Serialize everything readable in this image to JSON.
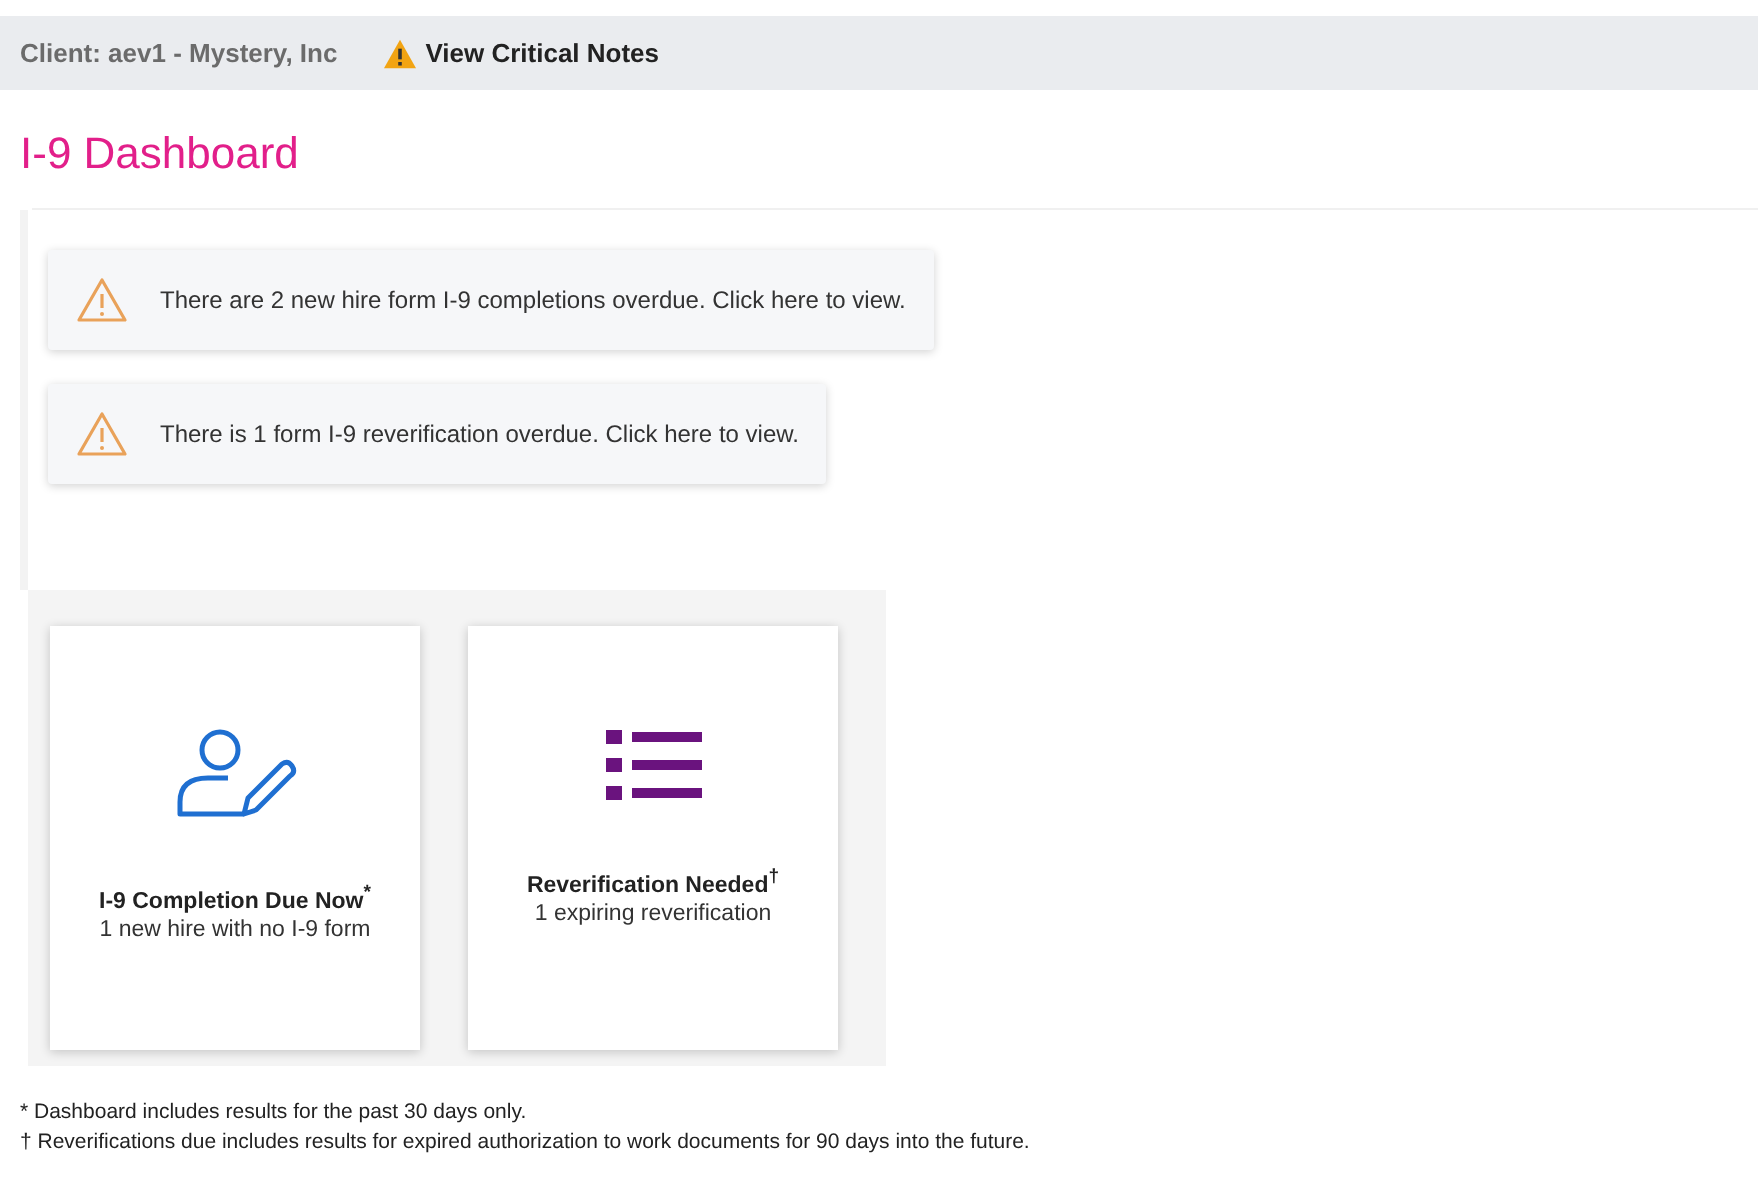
{
  "header": {
    "client": "Client: aev1 - Mystery, Inc",
    "critical_notes": "View Critical Notes"
  },
  "title": "I-9 Dashboard",
  "alerts": [
    "There are 2 new hire form I-9 completions overdue. Click here to view.",
    "There is 1 form I-9 reverification overdue. Click here to view."
  ],
  "cards": [
    {
      "kind": "person-edit",
      "title": "I-9 Completion Due Now$^{*}$",
      "subtitle": "1 new hire with no I-9 form"
    },
    {
      "kind": "list",
      "title": "Reverification Needed$^{†}$",
      "subtitle": "1 expiring reverification"
    }
  ],
  "footnotes": [
    "* Dashboard includes results for the past 30 days only.",
    "† Reverifications due includes results for expired authorization to work documents for 90 days into the future."
  ]
}
